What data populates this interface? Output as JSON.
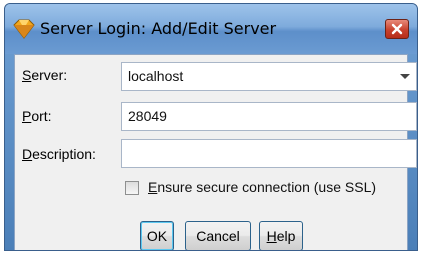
{
  "window": {
    "title": "Server Login: Add/Edit Server",
    "colors": {
      "titlebar": "#6b9bd2",
      "close": "#c8412d",
      "client": "#f0f0f0"
    }
  },
  "form": {
    "server": {
      "label_underlined": "S",
      "label_rest": "erver:",
      "value": "localhost",
      "icon": "chevron-down-icon"
    },
    "port": {
      "label_underlined": "P",
      "label_rest": "ort:",
      "value": "28049"
    },
    "description": {
      "label_underlined": "D",
      "label_rest": "escription:",
      "value": ""
    },
    "ssl": {
      "label_underlined": "E",
      "label_rest": "nsure secure connection (use SSL)",
      "checked": false
    }
  },
  "buttons": {
    "ok": "OK",
    "cancel": "Cancel",
    "help_underlined": "H",
    "help_rest": "elp"
  }
}
